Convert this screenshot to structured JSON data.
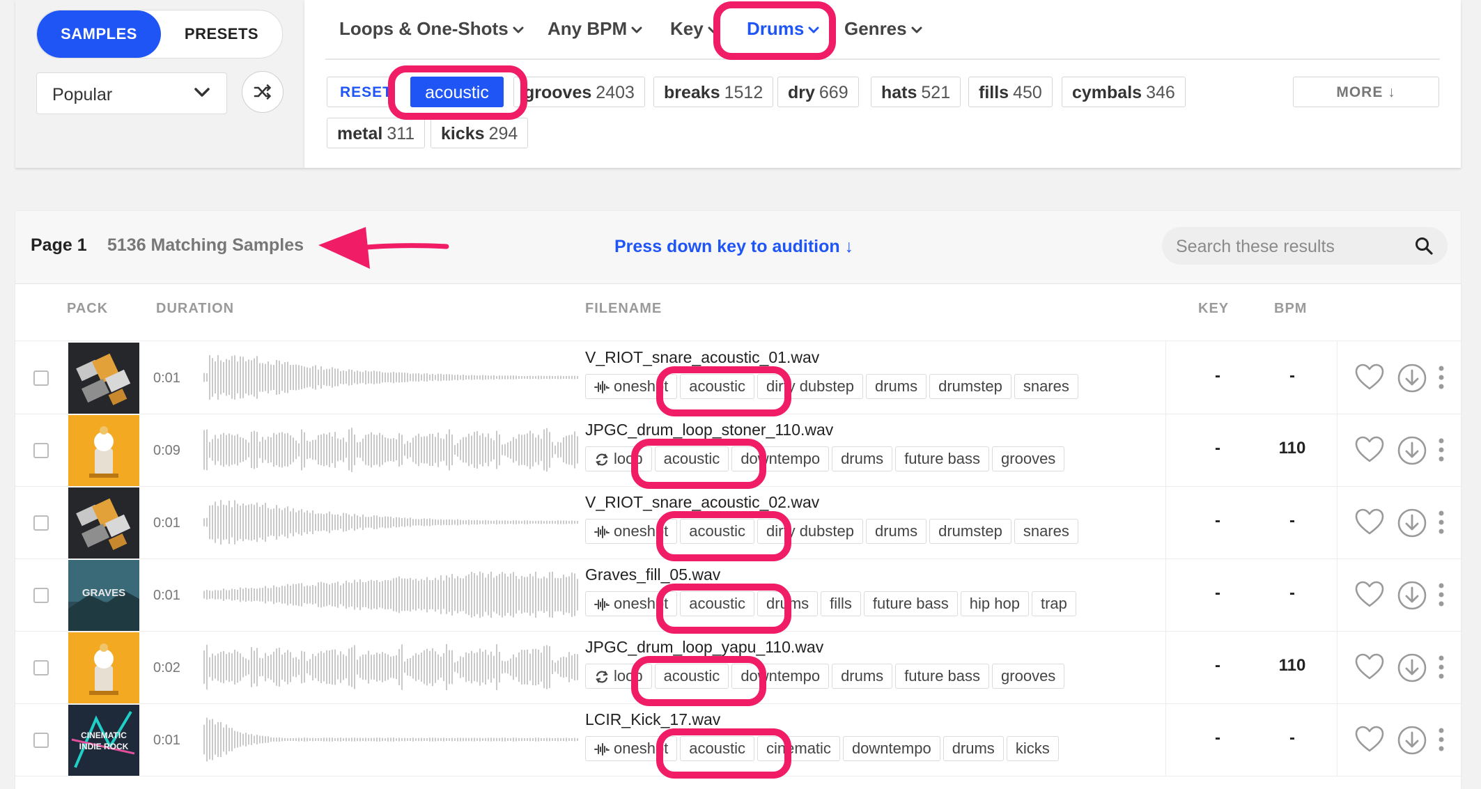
{
  "mode_toggle": {
    "samples": "SAMPLES",
    "presets": "PRESETS"
  },
  "sort": {
    "selected": "Popular"
  },
  "nav": [
    {
      "label": "Loops & One-Shots",
      "active": false
    },
    {
      "label": "Any BPM",
      "active": false
    },
    {
      "label": "Key",
      "active": false
    },
    {
      "label": "Drums",
      "active": true
    },
    {
      "label": "Genres",
      "active": false
    }
  ],
  "filters": {
    "reset": "RESET",
    "selected": "acoustic",
    "tags": [
      {
        "name": "grooves",
        "count": "2403"
      },
      {
        "name": "breaks",
        "count": "1512"
      },
      {
        "name": "dry",
        "count": "669"
      },
      {
        "name": "hats",
        "count": "521"
      },
      {
        "name": "fills",
        "count": "450"
      },
      {
        "name": "cymbals",
        "count": "346"
      },
      {
        "name": "metal",
        "count": "311"
      },
      {
        "name": "kicks",
        "count": "294"
      }
    ],
    "more": "MORE ↓"
  },
  "results_header": {
    "page": "Page 1",
    "count": "5136 Matching Samples",
    "hint": "Press down key to audition ↓",
    "search_placeholder": "Search these results"
  },
  "columns": {
    "pack": "PACK",
    "duration": "DURATION",
    "filename": "FILENAME",
    "key": "KEY",
    "bpm": "BPM"
  },
  "rows": [
    {
      "duration": "0:01",
      "filename": "V_RIOT_snare_acoustic_01.wav",
      "type": "oneshot",
      "type_label": "oneshot",
      "tags": [
        "acoustic",
        "dirty dubstep",
        "drums",
        "drumstep",
        "snares"
      ],
      "key": "-",
      "bpm": "-",
      "cover": "heavy-bass"
    },
    {
      "duration": "0:09",
      "filename": "JPGC_drum_loop_stoner_110.wav",
      "type": "loop",
      "type_label": "loop",
      "tags": [
        "acoustic",
        "downtempo",
        "drums",
        "future bass",
        "grooves"
      ],
      "key": "-",
      "bpm": "110",
      "cover": "orange"
    },
    {
      "duration": "0:01",
      "filename": "V_RIOT_snare_acoustic_02.wav",
      "type": "oneshot",
      "type_label": "oneshot",
      "tags": [
        "acoustic",
        "dirty dubstep",
        "drums",
        "drumstep",
        "snares"
      ],
      "key": "-",
      "bpm": "-",
      "cover": "heavy-bass"
    },
    {
      "duration": "0:01",
      "filename": "Graves_fill_05.wav",
      "type": "oneshot",
      "type_label": "oneshot",
      "tags": [
        "acoustic",
        "drums",
        "fills",
        "future bass",
        "hip hop",
        "trap"
      ],
      "key": "-",
      "bpm": "-",
      "cover": "graves"
    },
    {
      "duration": "0:02",
      "filename": "JPGC_drum_loop_yapu_110.wav",
      "type": "loop",
      "type_label": "loop",
      "tags": [
        "acoustic",
        "downtempo",
        "drums",
        "future bass",
        "grooves"
      ],
      "key": "-",
      "bpm": "110",
      "cover": "orange"
    },
    {
      "duration": "0:01",
      "filename": "LCIR_Kick_17.wav",
      "type": "oneshot",
      "type_label": "oneshot",
      "tags": [
        "acoustic",
        "cinematic",
        "downtempo",
        "drums",
        "kicks"
      ],
      "key": "-",
      "bpm": "-",
      "cover": "cinematic"
    }
  ],
  "colors": {
    "accent": "#1f55f5",
    "annotation": "#f01c66"
  }
}
